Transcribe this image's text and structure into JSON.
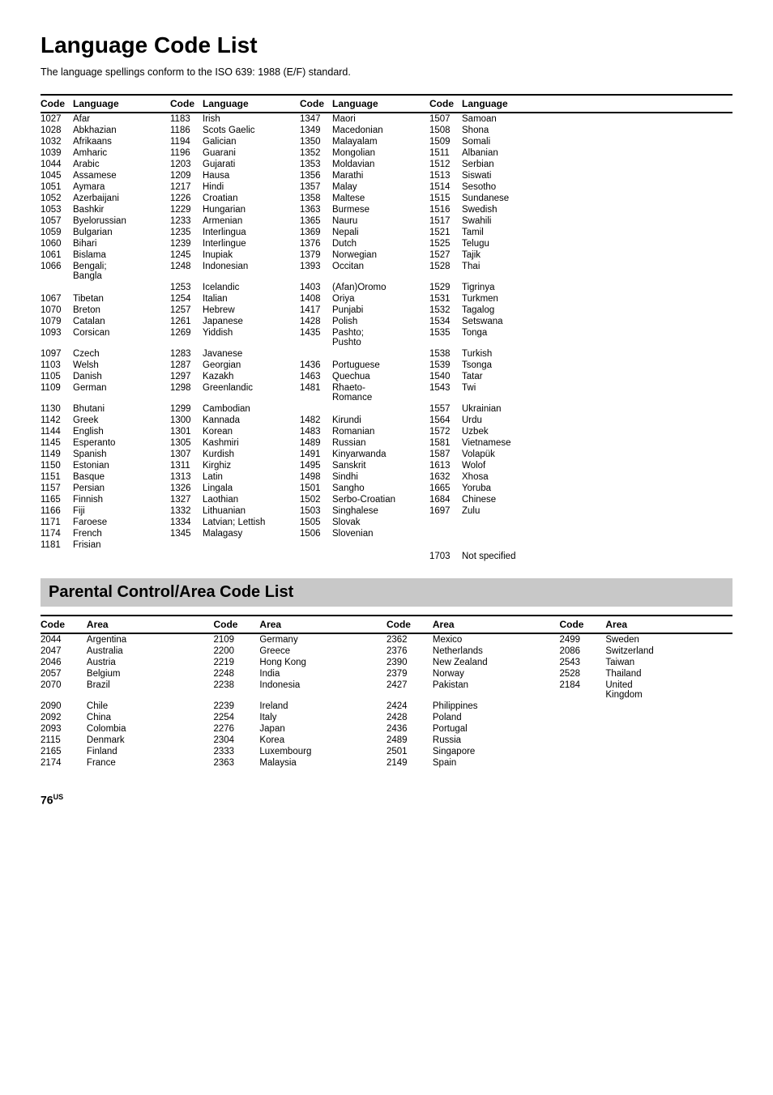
{
  "page": {
    "title": "Language Code List",
    "subtitle": "The language spellings conform to the ISO 639: 1988 (E/F) standard.",
    "page_number": "76",
    "page_suffix": "US"
  },
  "language_table": {
    "columns": [
      "Code",
      "Language",
      "Code",
      "Language",
      "Code",
      "Language",
      "Code",
      "Language"
    ],
    "rows": [
      [
        "1027",
        "Afar",
        "1183",
        "Irish",
        "1347",
        "Maori",
        "1507",
        "Samoan"
      ],
      [
        "1028",
        "Abkhazian",
        "1186",
        "Scots Gaelic",
        "1349",
        "Macedonian",
        "1508",
        "Shona"
      ],
      [
        "1032",
        "Afrikaans",
        "1194",
        "Galician",
        "1350",
        "Malayalam",
        "1509",
        "Somali"
      ],
      [
        "1039",
        "Amharic",
        "1196",
        "Guarani",
        "1352",
        "Mongolian",
        "1511",
        "Albanian"
      ],
      [
        "1044",
        "Arabic",
        "1203",
        "Gujarati",
        "1353",
        "Moldavian",
        "1512",
        "Serbian"
      ],
      [
        "1045",
        "Assamese",
        "1209",
        "Hausa",
        "1356",
        "Marathi",
        "1513",
        "Siswati"
      ],
      [
        "1051",
        "Aymara",
        "1217",
        "Hindi",
        "1357",
        "Malay",
        "1514",
        "Sesotho"
      ],
      [
        "1052",
        "Azerbaijani",
        "1226",
        "Croatian",
        "1358",
        "Maltese",
        "1515",
        "Sundanese"
      ],
      [
        "1053",
        "Bashkir",
        "1229",
        "Hungarian",
        "1363",
        "Burmese",
        "1516",
        "Swedish"
      ],
      [
        "1057",
        "Byelorussian",
        "1233",
        "Armenian",
        "1365",
        "Nauru",
        "1517",
        "Swahili"
      ],
      [
        "1059",
        "Bulgarian",
        "1235",
        "Interlingua",
        "1369",
        "Nepali",
        "1521",
        "Tamil"
      ],
      [
        "1060",
        "Bihari",
        "1239",
        "Interlingue",
        "1376",
        "Dutch",
        "1525",
        "Telugu"
      ],
      [
        "1061",
        "Bislama",
        "1245",
        "Inupiak",
        "1379",
        "Norwegian",
        "1527",
        "Tajik"
      ],
      [
        "1066",
        "Bengali; Bangla",
        "1248",
        "Indonesian",
        "1393",
        "Occitan",
        "1528",
        "Thai"
      ],
      [
        "",
        "",
        "1253",
        "Icelandic",
        "1403",
        "(Afan)Oromo",
        "1529",
        "Tigrinya"
      ],
      [
        "1067",
        "Tibetan",
        "1254",
        "Italian",
        "1408",
        "Oriya",
        "1531",
        "Turkmen"
      ],
      [
        "1070",
        "Breton",
        "1257",
        "Hebrew",
        "1417",
        "Punjabi",
        "1532",
        "Tagalog"
      ],
      [
        "1079",
        "Catalan",
        "1261",
        "Japanese",
        "1428",
        "Polish",
        "1534",
        "Setswana"
      ],
      [
        "1093",
        "Corsican",
        "1269",
        "Yiddish",
        "1435",
        "Pashto; Pushto",
        "1535",
        "Tonga"
      ],
      [
        "1097",
        "Czech",
        "1283",
        "Javanese",
        "",
        "",
        "1538",
        "Turkish"
      ],
      [
        "1103",
        "Welsh",
        "1287",
        "Georgian",
        "1436",
        "Portuguese",
        "1539",
        "Tsonga"
      ],
      [
        "1105",
        "Danish",
        "1297",
        "Kazakh",
        "1463",
        "Quechua",
        "1540",
        "Tatar"
      ],
      [
        "1109",
        "German",
        "1298",
        "Greenlandic",
        "1481",
        "Rhaeto-Romance",
        "1543",
        "Twi"
      ],
      [
        "1130",
        "Bhutani",
        "1299",
        "Cambodian",
        "",
        "",
        "1557",
        "Ukrainian"
      ],
      [
        "1142",
        "Greek",
        "1300",
        "Kannada",
        "1482",
        "Kirundi",
        "1564",
        "Urdu"
      ],
      [
        "1144",
        "English",
        "1301",
        "Korean",
        "1483",
        "Romanian",
        "1572",
        "Uzbek"
      ],
      [
        "1145",
        "Esperanto",
        "1305",
        "Kashmiri",
        "1489",
        "Russian",
        "1581",
        "Vietnamese"
      ],
      [
        "1149",
        "Spanish",
        "1307",
        "Kurdish",
        "1491",
        "Kinyarwanda",
        "1587",
        "Volapük"
      ],
      [
        "1150",
        "Estonian",
        "1311",
        "Kirghiz",
        "1495",
        "Sanskrit",
        "1613",
        "Wolof"
      ],
      [
        "1151",
        "Basque",
        "1313",
        "Latin",
        "1498",
        "Sindhi",
        "1632",
        "Xhosa"
      ],
      [
        "1157",
        "Persian",
        "1326",
        "Lingala",
        "1501",
        "Sangho",
        "1665",
        "Yoruba"
      ],
      [
        "1165",
        "Finnish",
        "1327",
        "Laothian",
        "1502",
        "Serbo-Croatian",
        "1684",
        "Chinese"
      ],
      [
        "1166",
        "Fiji",
        "1332",
        "Lithuanian",
        "1503",
        "Singhalese",
        "1697",
        "Zulu"
      ],
      [
        "1171",
        "Faroese",
        "1334",
        "Latvian; Lettish",
        "1505",
        "Slovak",
        "",
        ""
      ],
      [
        "1174",
        "French",
        "1345",
        "Malagasy",
        "1506",
        "Slovenian",
        "",
        ""
      ],
      [
        "1181",
        "Frisian",
        "",
        "",
        "",
        "",
        "",
        ""
      ],
      [
        "",
        "",
        "",
        "",
        "",
        "",
        "1703",
        "Not specified"
      ]
    ]
  },
  "parental_section": {
    "title": "Parental Control/Area Code List"
  },
  "area_table": {
    "columns": [
      "Code",
      "Area",
      "Code",
      "Area",
      "Code",
      "Area",
      "Code",
      "Area"
    ],
    "rows": [
      [
        "2044",
        "Argentina",
        "2109",
        "Germany",
        "2362",
        "Mexico",
        "2499",
        "Sweden"
      ],
      [
        "2047",
        "Australia",
        "2200",
        "Greece",
        "2376",
        "Netherlands",
        "2086",
        "Switzerland"
      ],
      [
        "2046",
        "Austria",
        "2219",
        "Hong Kong",
        "2390",
        "New Zealand",
        "2543",
        "Taiwan"
      ],
      [
        "2057",
        "Belgium",
        "2248",
        "India",
        "2379",
        "Norway",
        "2528",
        "Thailand"
      ],
      [
        "2070",
        "Brazil",
        "2238",
        "Indonesia",
        "2427",
        "Pakistan",
        "2184",
        "United Kingdom"
      ],
      [
        "2090",
        "Chile",
        "2239",
        "Ireland",
        "2424",
        "Philippines",
        "",
        ""
      ],
      [
        "2092",
        "China",
        "2254",
        "Italy",
        "2428",
        "Poland",
        "",
        ""
      ],
      [
        "2093",
        "Colombia",
        "2276",
        "Japan",
        "2436",
        "Portugal",
        "",
        ""
      ],
      [
        "2115",
        "Denmark",
        "2304",
        "Korea",
        "2489",
        "Russia",
        "",
        ""
      ],
      [
        "2165",
        "Finland",
        "2333",
        "Luxembourg",
        "2501",
        "Singapore",
        "",
        ""
      ],
      [
        "2174",
        "France",
        "2363",
        "Malaysia",
        "2149",
        "Spain",
        "",
        ""
      ]
    ]
  }
}
